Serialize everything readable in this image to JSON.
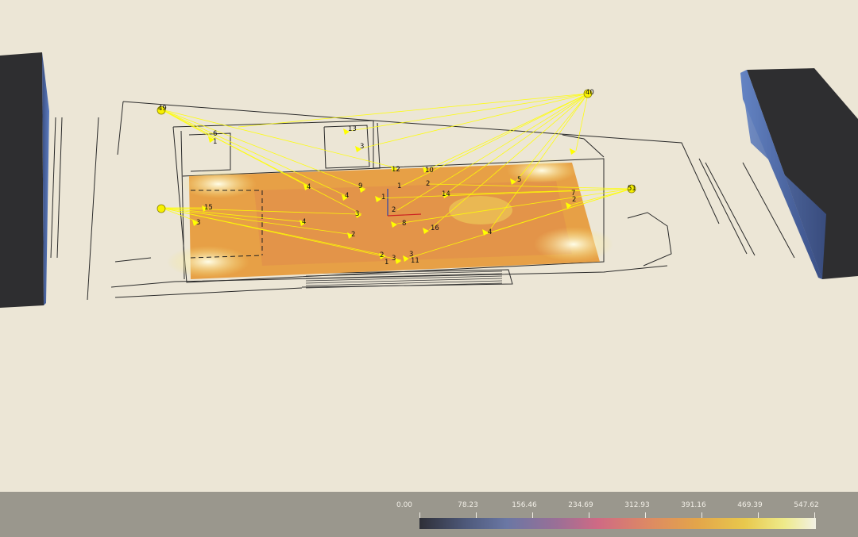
{
  "scene": {
    "labels": [
      "49",
      "40",
      "51",
      "13",
      "3",
      "6",
      "1",
      "12",
      "10",
      "4",
      "9",
      "1",
      "2",
      "14",
      "5",
      "4",
      "1",
      "2",
      "3",
      "15",
      "3",
      "8",
      "4",
      "2",
      "16",
      "4",
      "2",
      "3",
      "3",
      "1",
      "11",
      "2",
      "7"
    ]
  },
  "legend": {
    "ticks": [
      "0.00",
      "78.23",
      "156.46",
      "234.69",
      "312.93",
      "391.16",
      "469.39",
      "547.62"
    ]
  },
  "colors": {
    "background": "#ece6d6",
    "legend_bar": "#9a978d",
    "lux_low": "#2e2f37",
    "lux_high": "#f2f1e4",
    "ray": "#ffff00"
  }
}
